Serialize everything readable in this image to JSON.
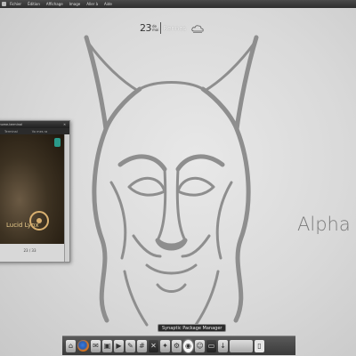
{
  "topbar": {
    "menu": [
      "Fichier",
      "Édition",
      "Affichage",
      "Image",
      "Aller à",
      "Aide"
    ]
  },
  "clock": {
    "day": "23",
    "day_suffix": "de",
    "month": "mai",
    "weather": "Rennes",
    "weather_icon": "cloud-icon"
  },
  "desktop": {
    "alpha_text": "Alpha"
  },
  "window": {
    "title": "gnome-terminal",
    "tabs": [
      "Terminal",
      "Vo mes ra"
    ],
    "brand_text": "Lucid Lynx",
    "status": "23 / 33"
  },
  "dock": {
    "tooltip": "Synaptic Package Manager",
    "items": [
      {
        "icon": "home-folder-icon"
      },
      {
        "icon": "firefox-icon"
      },
      {
        "icon": "mail-icon"
      },
      {
        "icon": "image-viewer-icon"
      },
      {
        "icon": "video-icon"
      },
      {
        "icon": "editor-icon"
      },
      {
        "icon": "calculator-icon"
      },
      {
        "icon": "terminal-icon"
      },
      {
        "icon": "graphics-icon"
      },
      {
        "icon": "tools-icon"
      },
      {
        "icon": "synaptic-icon"
      },
      {
        "icon": "chat-icon"
      },
      {
        "icon": "screen-icon"
      },
      {
        "icon": "download-icon"
      },
      {
        "icon": "workspace-switcher-icon"
      },
      {
        "icon": "trash-icon"
      }
    ]
  },
  "colors": {
    "topbar": "#2e2e2e",
    "desktop": "#d9d9d9",
    "lynx_stroke": "#8a8a8a",
    "dock": "#3a3a3a"
  }
}
